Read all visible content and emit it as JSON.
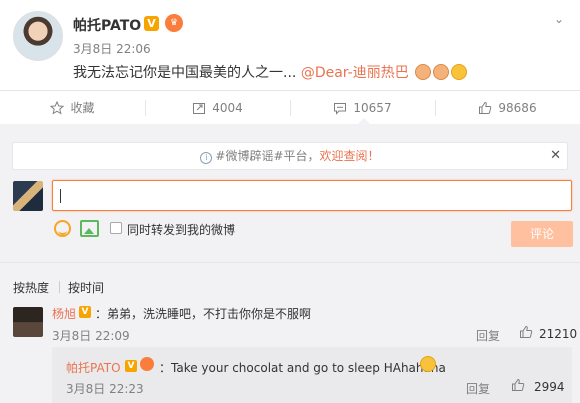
{
  "post": {
    "author": "帕托PATO",
    "verified_badge": "V",
    "time": "3月8日 22:06",
    "text": "我无法忘记你是中国最美的人之一... ",
    "mention": "@Dear-迪丽热巴"
  },
  "actions": {
    "favorite_label": "收藏",
    "repost_count": "4004",
    "comment_count": "10657",
    "like_count": "98686"
  },
  "notice": {
    "hashtag": "#微博辟谣#平台，",
    "link_text": "欢迎查阅！"
  },
  "composer": {
    "repost_checkbox_label": "同时转发到我的微博",
    "submit_label": "评论"
  },
  "sort": {
    "hot_label": "按热度",
    "time_label": "按时间"
  },
  "comment": {
    "author": "杨旭",
    "badge": "V",
    "text": "：弟弟，洗洗睡吧，不打击你你是不服啊",
    "time": "3月8日 22:09",
    "reply_label": "回复",
    "likes": "21210"
  },
  "reply": {
    "author": "帕托PATO",
    "badge": "V",
    "text": "：Take your chocolat and go to sleep HAhahaha",
    "time": "3月8日 22:23",
    "reply_label": "回复",
    "likes": "2994"
  },
  "colors": {
    "accent": "#eb7350",
    "badge": "#f7a400",
    "panel": "#f2f2f5"
  }
}
